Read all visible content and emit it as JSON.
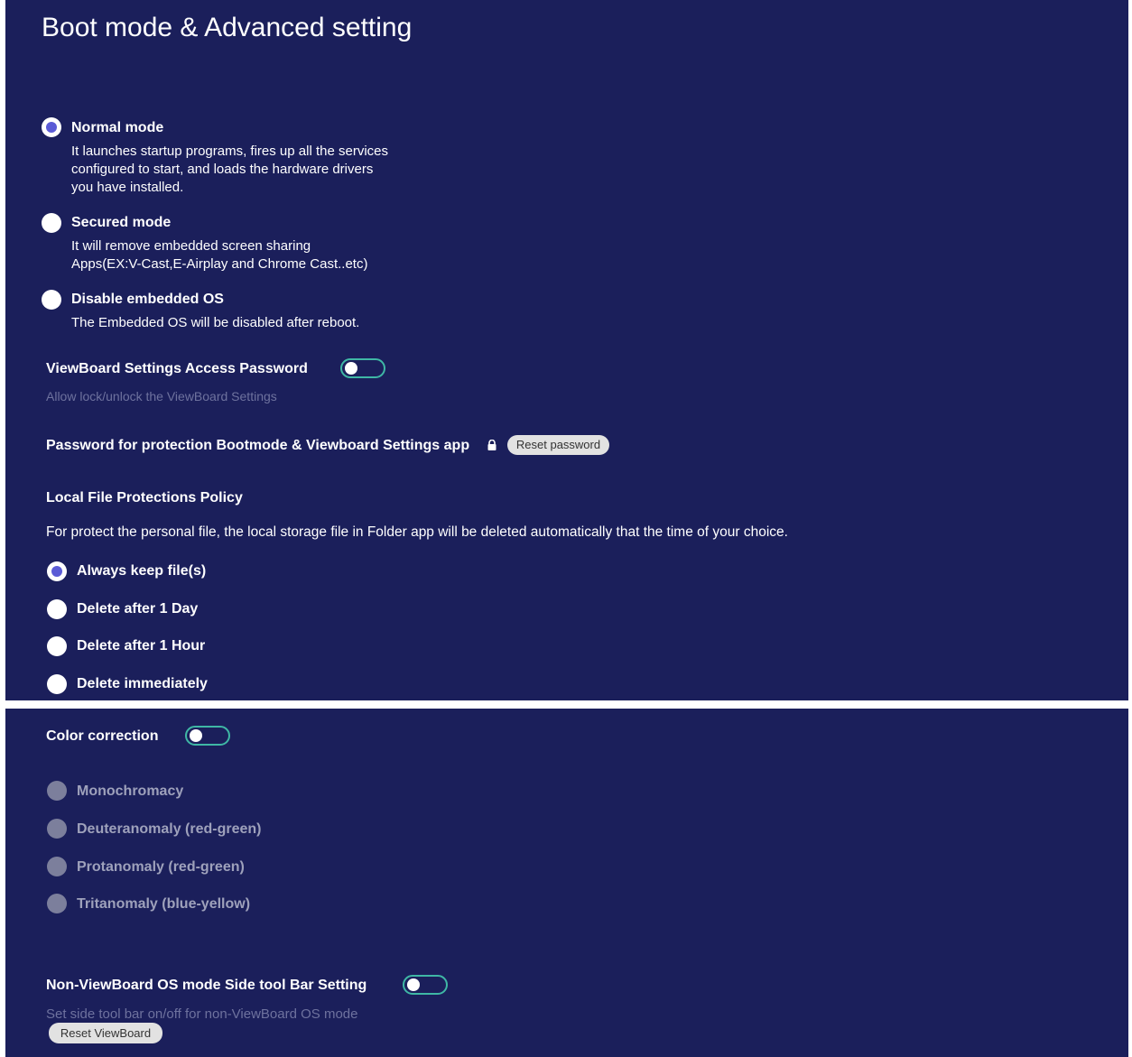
{
  "header": {
    "title": "Boot mode & Advanced setting"
  },
  "boot_modes": [
    {
      "label": "Normal mode",
      "selected": true,
      "description": "It launches startup programs, fires up all the services\nconfigured to start, and loads the hardware drivers\nyou have installed."
    },
    {
      "label": "Secured mode",
      "selected": false,
      "description": "It will remove embedded screen sharing\nApps(EX:V-Cast,E-Airplay and Chrome Cast..etc)"
    },
    {
      "label": "Disable embedded OS",
      "selected": false,
      "description": "The Embedded OS will be disabled after reboot."
    }
  ],
  "access_password": {
    "label": "ViewBoard Settings Access Password",
    "enabled": false,
    "subtitle": "Allow lock/unlock the ViewBoard Settings"
  },
  "protection_password": {
    "label": "Password for protection Bootmode & Viewboard Settings app",
    "icon": "lock-icon",
    "reset_label": "Reset password"
  },
  "file_policy": {
    "heading": "Local File Protections Policy",
    "description": "For protect the personal file, the local storage file in Folder app will be deleted automatically that the time of your choice.",
    "options": [
      {
        "label": "Always keep file(s)",
        "selected": true
      },
      {
        "label": "Delete after 1 Day",
        "selected": false
      },
      {
        "label": "Delete after 1 Hour",
        "selected": false
      },
      {
        "label": "Delete immediately",
        "selected": false
      }
    ]
  },
  "color_correction": {
    "label": "Color correction",
    "enabled": false,
    "options": [
      {
        "label": "Monochromacy"
      },
      {
        "label": "Deuteranomaly (red-green)"
      },
      {
        "label": "Protanomaly (red-green)"
      },
      {
        "label": "Tritanomaly (blue-yellow)"
      }
    ]
  },
  "side_toolbar": {
    "label": "Non-ViewBoard OS mode Side tool Bar Setting",
    "enabled": false,
    "subtitle": "Set side tool bar on/off for non-ViewBoard OS mode"
  },
  "reset": {
    "label": "Reset ViewBoard"
  },
  "colors": {
    "background": "#1b1f5b",
    "accent": "#5b5bd6",
    "toggle_border": "#3fb7a5"
  }
}
